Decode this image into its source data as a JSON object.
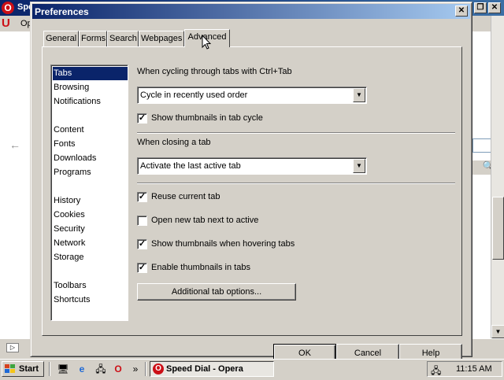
{
  "background_window": {
    "title": "Spe",
    "menu_text": "Op"
  },
  "dialog": {
    "title": "Preferences",
    "tabs": [
      "General",
      "Forms",
      "Search",
      "Webpages",
      "Advanced"
    ],
    "active_tab": "Advanced",
    "categories": [
      "Tabs",
      "Browsing",
      "Notifications",
      "Content",
      "Fonts",
      "Downloads",
      "Programs",
      "History",
      "Cookies",
      "Security",
      "Network",
      "Storage",
      "Toolbars",
      "Shortcuts"
    ],
    "selected_category": "Tabs",
    "cycling_label": "When cycling through tabs with Ctrl+Tab",
    "cycling_select_value": "Cycle in recently used order",
    "show_thumbnails_cycle": {
      "label": "Show thumbnails in tab cycle",
      "checked": true
    },
    "closing_label": "When closing a tab",
    "closing_select_value": "Activate the last active tab",
    "reuse_current_tab": {
      "label": "Reuse current tab",
      "checked": true
    },
    "open_next_to_active": {
      "label": "Open new tab next to active",
      "checked": false
    },
    "thumbnails_hover": {
      "label": "Show thumbnails when hovering tabs",
      "checked": true
    },
    "enable_thumbnails": {
      "label": "Enable thumbnails in tabs",
      "checked": true
    },
    "additional_button": "Additional tab options...",
    "ok_button": "OK",
    "cancel_button": "Cancel",
    "help_button": "Help"
  },
  "taskbar": {
    "start_label": "Start",
    "task_label": "Speed Dial - Opera",
    "clock": "11:15 AM"
  },
  "colors": {
    "title_active": "#0a246a",
    "selection": "#0a246a",
    "face": "#d4d0c8",
    "opera_red": "#cc0f16"
  }
}
